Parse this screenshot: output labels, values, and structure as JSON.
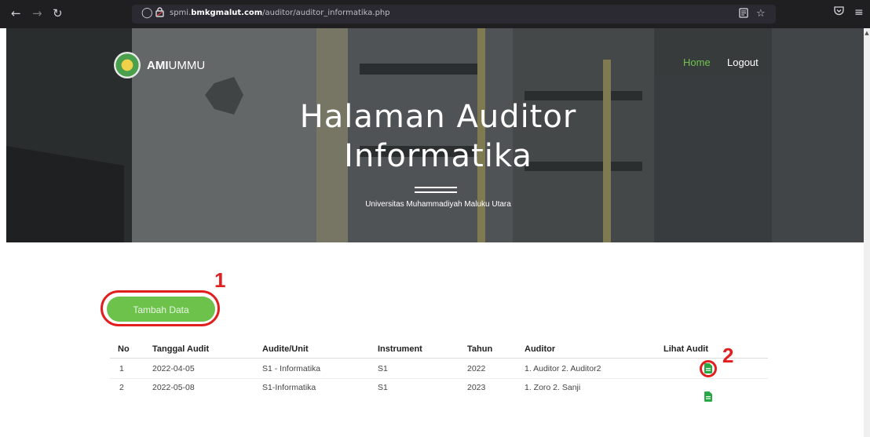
{
  "browser": {
    "url_prefix": "spmi.",
    "url_domain": "bmkgmalut.com",
    "url_path": "/auditor/auditor_informatika.php",
    "icons": [
      "back-icon",
      "forward-icon",
      "reload-icon",
      "shield-icon",
      "lock-icon",
      "reader-icon",
      "star-icon",
      "pocket-icon",
      "menu-icon"
    ]
  },
  "brand": {
    "bold": "AMI",
    "light": "UMMU"
  },
  "nav": {
    "home": "Home",
    "logout": "Logout"
  },
  "hero": {
    "title_line1": "Halaman Auditor",
    "title_line2": "Informatika",
    "subtitle": "Universitas Muhammadiyah Maluku Utara"
  },
  "actions": {
    "add_label": "Tambah Data"
  },
  "annotations": {
    "one": "1",
    "two": "2",
    "color": "#e21f1f"
  },
  "table": {
    "headers": [
      "No",
      "Tanggal Audit",
      "Audite/Unit",
      "Instrument",
      "Tahun",
      "Auditor",
      "Lihat Audit"
    ],
    "rows": [
      {
        "no": "1",
        "tanggal": "2022-04-05",
        "unit": "S1 - Informatika",
        "instrument": "S1",
        "tahun": "2022",
        "auditor": "1. Auditor 2. Auditor2"
      },
      {
        "no": "2",
        "tanggal": "2022-05-08",
        "unit": "S1-Informatika",
        "instrument": "S1",
        "tahun": "2023",
        "auditor": "1. Zoro 2. Sanji"
      }
    ]
  },
  "colors": {
    "accent": "#6cc24a",
    "icon_green": "#27a844"
  }
}
